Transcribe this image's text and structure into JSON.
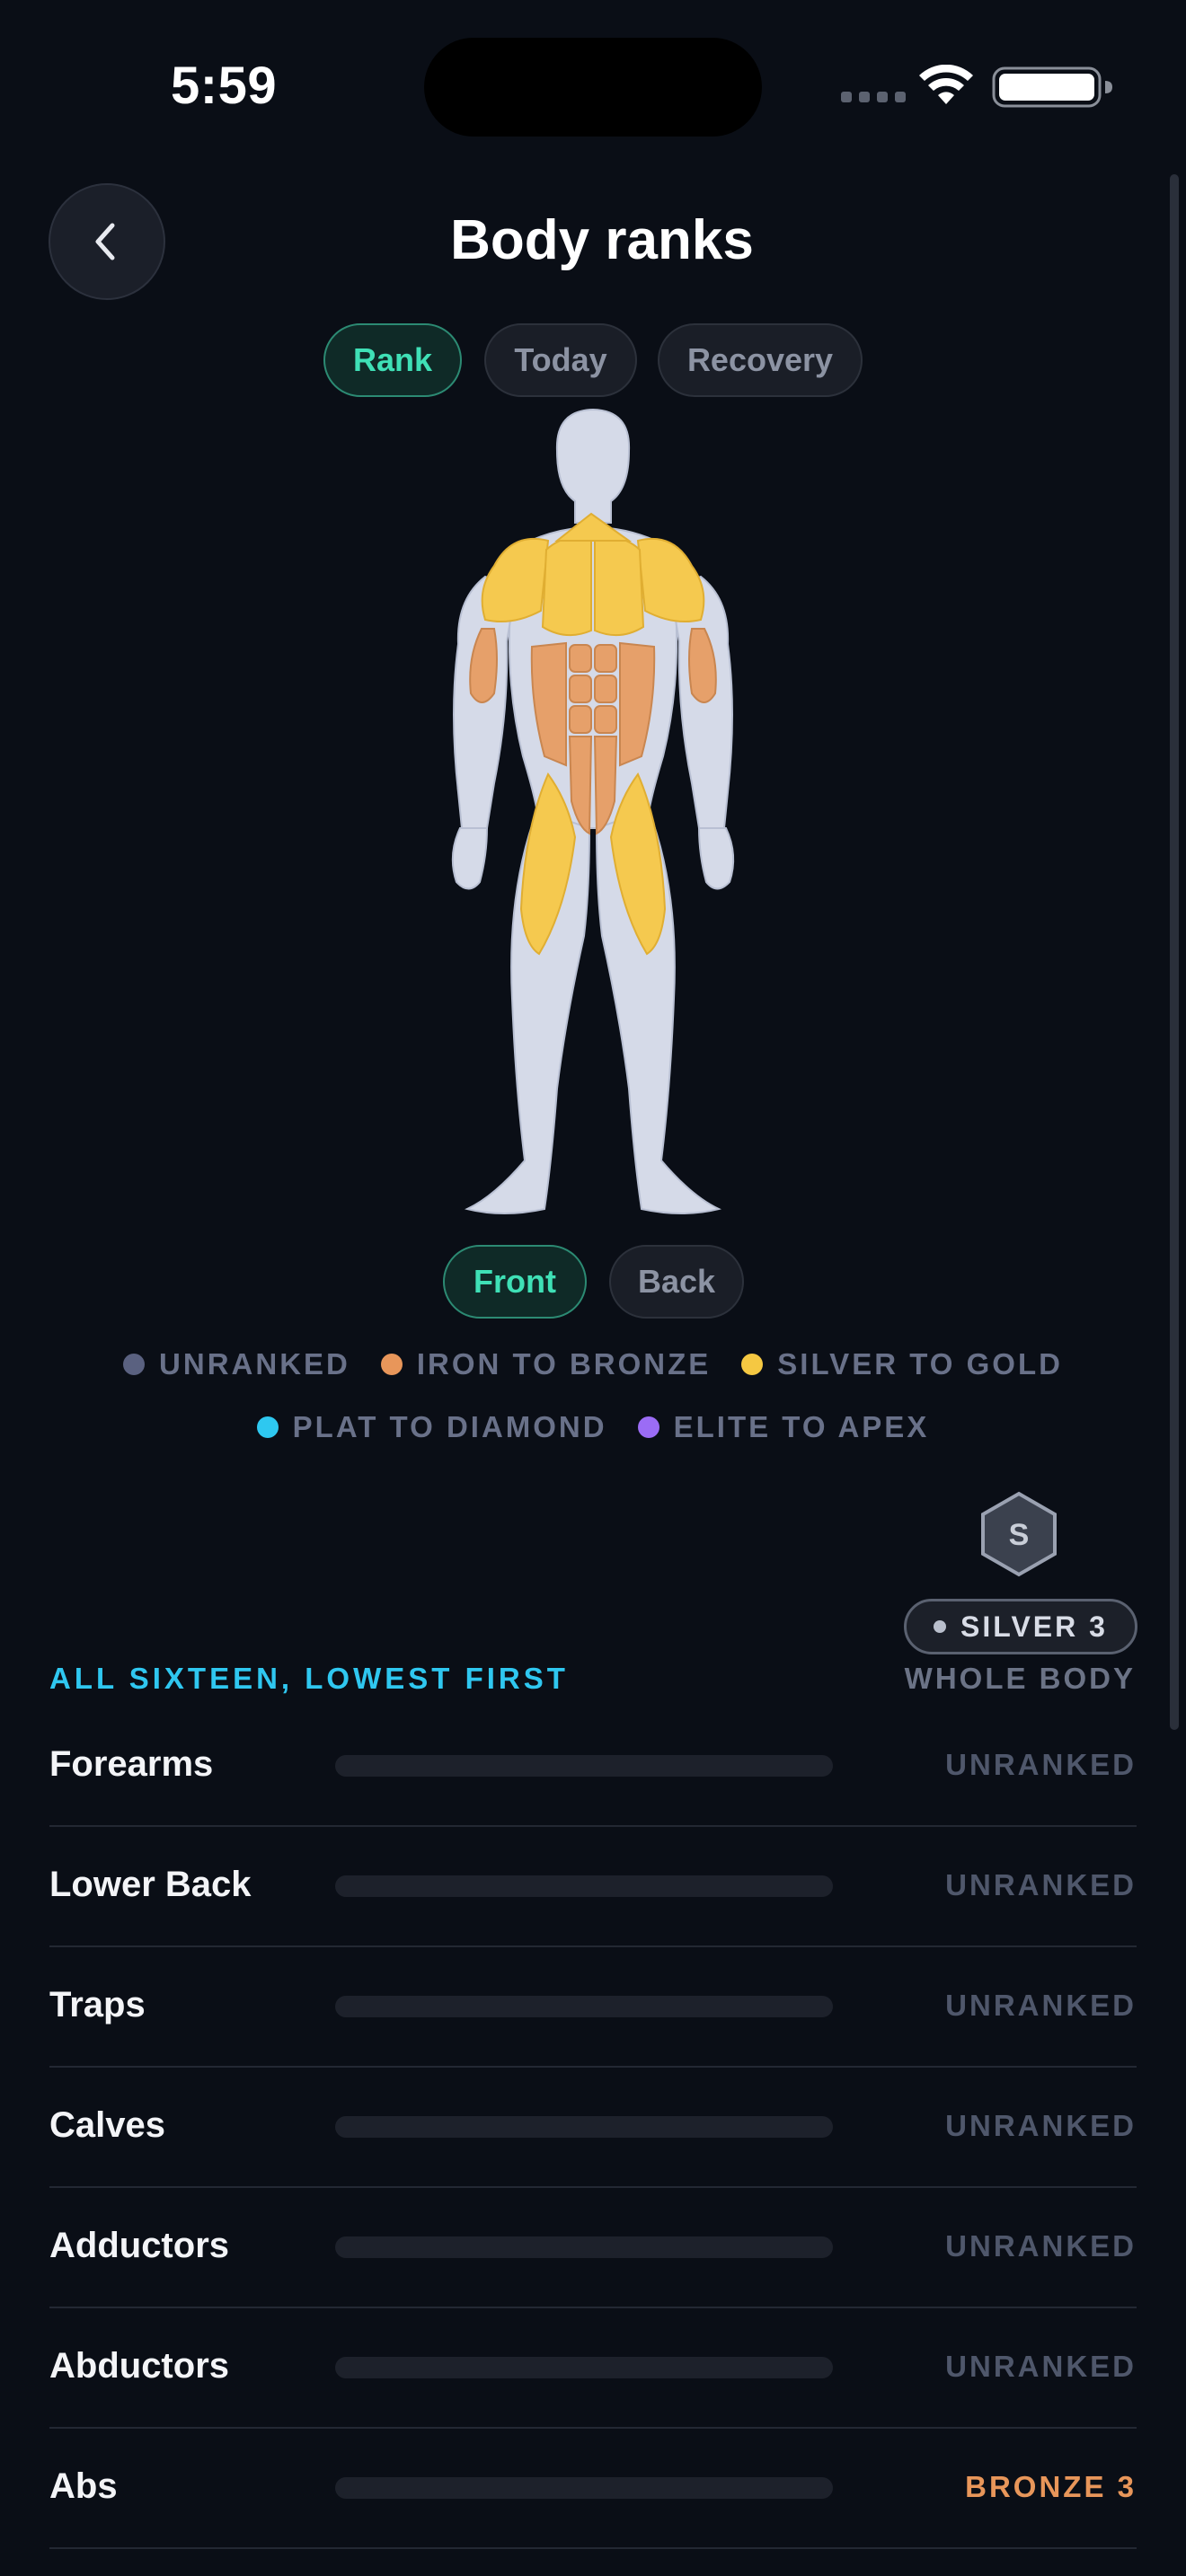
{
  "status_bar": {
    "time": "5:59"
  },
  "header": {
    "title": "Body ranks",
    "back_icon": "chevron-left-icon"
  },
  "mode_tabs": [
    {
      "label": "Rank",
      "active": true
    },
    {
      "label": "Today",
      "active": false
    },
    {
      "label": "Recovery",
      "active": false
    }
  ],
  "view_toggle": [
    {
      "label": "Front",
      "active": true
    },
    {
      "label": "Back",
      "active": false
    }
  ],
  "legend": [
    {
      "label": "UNRANKED",
      "color": "#5a6180"
    },
    {
      "label": "IRON TO BRONZE",
      "color": "#e8965a"
    },
    {
      "label": "SILVER TO GOLD",
      "color": "#f5c842"
    },
    {
      "label": "PLAT TO DIAMOND",
      "color": "#2ec8f0"
    },
    {
      "label": "ELITE TO APEX",
      "color": "#9b6cf5"
    }
  ],
  "whole_body": {
    "badge_letter": "S",
    "rank": "SILVER 3",
    "label": "WHOLE BODY"
  },
  "section_label": "ALL SIXTEEN, LOWEST FIRST",
  "muscles": [
    {
      "name": "Forearms",
      "rank": "UNRANKED",
      "progress": 0,
      "color": "#4f576b"
    },
    {
      "name": "Lower Back",
      "rank": "UNRANKED",
      "progress": 0,
      "color": "#4f576b"
    },
    {
      "name": "Traps",
      "rank": "UNRANKED",
      "progress": 0,
      "color": "#4f576b"
    },
    {
      "name": "Calves",
      "rank": "UNRANKED",
      "progress": 0,
      "color": "#4f576b"
    },
    {
      "name": "Adductors",
      "rank": "UNRANKED",
      "progress": 0,
      "color": "#4f576b"
    },
    {
      "name": "Abductors",
      "rank": "UNRANKED",
      "progress": 0,
      "color": "#4f576b"
    },
    {
      "name": "Abs",
      "rank": "BRONZE 3",
      "progress": 0,
      "color": "#e8965a"
    }
  ]
}
